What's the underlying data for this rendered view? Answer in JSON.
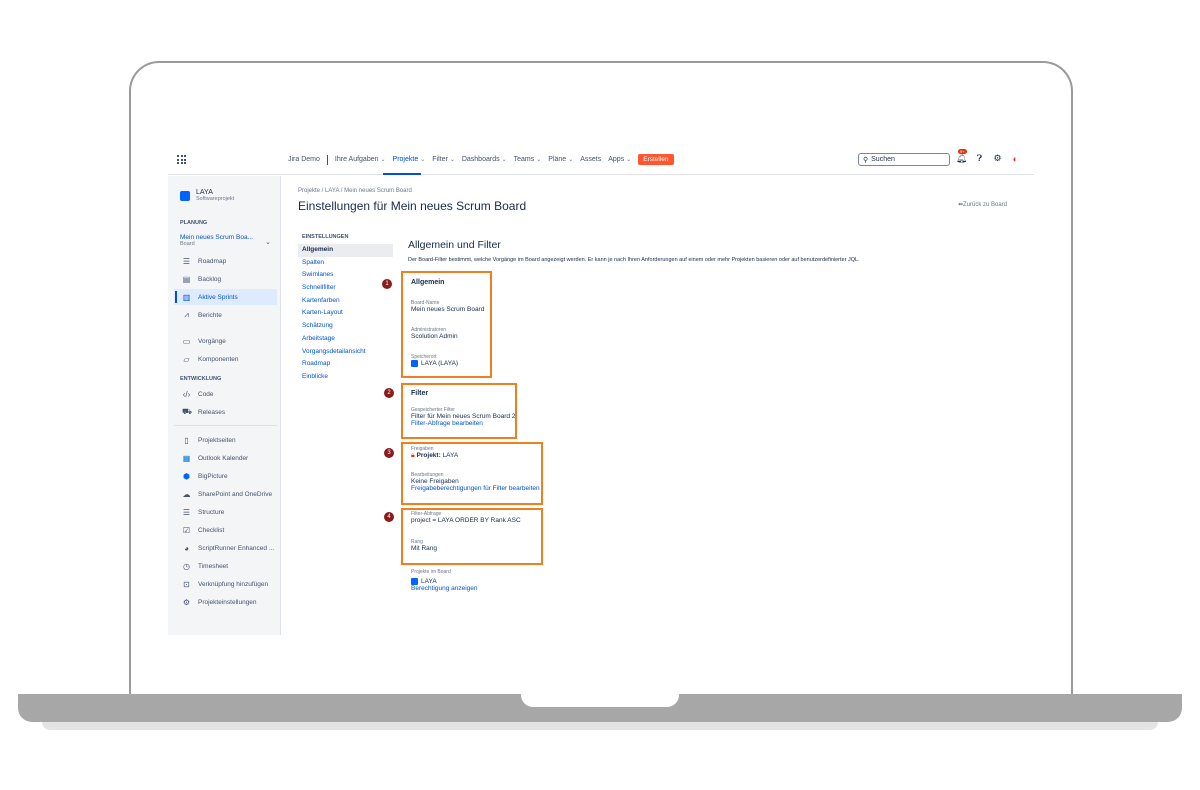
{
  "topnav": {
    "items": [
      {
        "label": "Jira Demo"
      },
      {
        "label": "Ihre Aufgaben"
      },
      {
        "label": "Projekte"
      },
      {
        "label": "Filter"
      },
      {
        "label": "Dashboards"
      },
      {
        "label": "Teams"
      },
      {
        "label": "Pläne"
      },
      {
        "label": "Assets"
      },
      {
        "label": "Apps"
      }
    ],
    "create": "Erstellen",
    "search_placeholder": "Suchen",
    "notification_badge": "9+",
    "accent": "#0052cc",
    "create_color": "#ff5630"
  },
  "sidebar": {
    "project_name": "LAYA",
    "project_type": "Softwareprojekt",
    "planning_title": "PLANUNG",
    "board_name": "Mein neues Scrum Boa...",
    "board_type": "Board",
    "planning_items": [
      {
        "label": "Roadmap",
        "icon": "roadmap-icon"
      },
      {
        "label": "Backlog",
        "icon": "backlog-icon"
      },
      {
        "label": "Aktive Sprints",
        "icon": "board-icon"
      },
      {
        "label": "Berichte",
        "icon": "chart-icon"
      }
    ],
    "items2": [
      {
        "label": "Vorgänge",
        "icon": "issues-icon"
      },
      {
        "label": "Komponenten",
        "icon": "components-icon"
      }
    ],
    "dev_title": "ENTWICKLUNG",
    "dev_items": [
      {
        "label": "Code",
        "icon": "code-icon"
      },
      {
        "label": "Releases",
        "icon": "releases-icon"
      }
    ],
    "app_items": [
      {
        "label": "Projektseiten",
        "icon": "page-icon"
      },
      {
        "label": "Outlook Kalender",
        "icon": "outlook-icon"
      },
      {
        "label": "BigPicture",
        "icon": "bigpicture-icon"
      },
      {
        "label": "SharePoint and OneDrive",
        "icon": "cloud-icon"
      },
      {
        "label": "Structure",
        "icon": "structure-icon"
      },
      {
        "label": "Checklist",
        "icon": "checklist-icon"
      },
      {
        "label": "ScriptRunner Enhanced ...",
        "icon": "scriptrunner-icon"
      },
      {
        "label": "Timesheet",
        "icon": "clock-icon"
      },
      {
        "label": "Verknüpfung hinzufügen",
        "icon": "add-link-icon"
      },
      {
        "label": "Projekteinstellungen",
        "icon": "gear-icon"
      }
    ]
  },
  "main": {
    "breadcrumb": "Projekte  /  LAYA  /  Mein neues Scrum Board",
    "title": "Einstellungen für Mein neues Scrum Board",
    "back": "Zurück zu Board",
    "settings_heading": "EINSTELLUNGEN",
    "settings_nav": [
      "Allgemein",
      "Spalten",
      "Swimlanes",
      "Schnellfilter",
      "Kartenfarben",
      "Karten-Layout",
      "Schätzung",
      "Arbeitstage",
      "Vorgangsdetailansicht",
      "Roadmap",
      "Einblicke"
    ],
    "content_title": "Allgemein und Filter",
    "content_desc": "Der Board-Filter bestimmt, welche Vorgänge im Board angezeigt werden. Er kann je nach Ihren Anforderungen auf einem oder mehr Projekten basieren oder auf benutzerdefinierter JQL.",
    "general": {
      "heading": "Allgemein",
      "board_name_label": "Board-Name",
      "board_name": "Mein neues Scrum Board",
      "admins_label": "Administratoren",
      "admins": "Scolution Admin",
      "location_label": "Speicherort",
      "location": "LAYA (LAYA)"
    },
    "filter": {
      "heading": "Filter",
      "saved_label": "Gespeicherter Filter",
      "saved": "Filter für Mein neues Scrum Board 2",
      "edit_link": "Filter-Abfrage bearbeiten",
      "shares_label": "Freigaben",
      "shares_prefix": "Projekt:",
      "shares_value": "LAYA",
      "edit_label": "Bearbeitungen",
      "edit_value": "Keine Freigaben",
      "edit_perm_link": "Freigabeberechtigungen für Filter bearbeiten",
      "query_label": "Filter-Abfrage",
      "query": "project = LAYA ORDER BY Rank ASC",
      "rank_label": "Rang",
      "rank": "Mit Rang",
      "projects_label": "Projekte im Board",
      "project": "LAYA",
      "permission_link": "Berechtigung anzeigen"
    },
    "markers": [
      "1",
      "2",
      "3",
      "4"
    ],
    "highlight_color": "#f07f21",
    "marker_color": "#8b1a1a"
  }
}
